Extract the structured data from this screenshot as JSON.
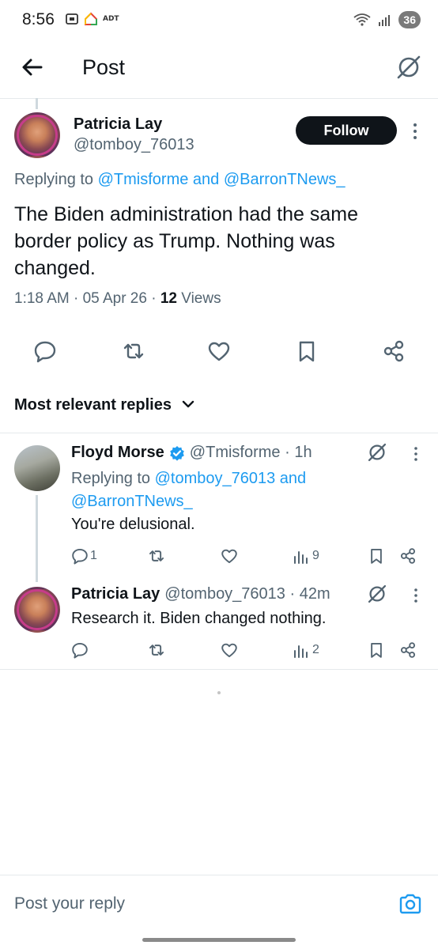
{
  "status_bar": {
    "time": "8:56",
    "adt": "ADT",
    "battery": "36",
    "signal_label": "5"
  },
  "header": {
    "title": "Post"
  },
  "post": {
    "author_name": "Patricia Lay",
    "author_handle": "@tomboy_76013",
    "follow_label": "Follow",
    "replying_prefix": "Replying to",
    "replying_to": "@Tmisforme and @BarronTNews_",
    "text": "The Biden administration had the same border policy as Trump. Nothing was changed.",
    "time": "1:18 AM · 05 Apr 26 · ",
    "views_count": "12",
    "views_label": " Views"
  },
  "sort": {
    "label": "Most relevant replies"
  },
  "replies": [
    {
      "author_name": "Floyd Morse",
      "author_handle": "@Tmisforme · 1h",
      "replying_prefix": "Replying to",
      "replying_to_1": "@tomboy_76013 and",
      "replying_to_2": "@BarronTNews_",
      "text": "You're delusional.",
      "reply_count": "1",
      "views": "9"
    },
    {
      "author_name": "Patricia Lay",
      "author_handle": "@tomboy_76013 · 42m",
      "text": "Research it. Biden changed nothing.",
      "views": "2"
    }
  ],
  "composer": {
    "placeholder": "Post your reply"
  },
  "colors": {
    "accent": "#1d9bf0",
    "text": "#0f1419",
    "muted": "#536471",
    "verified": "#1d9bf0"
  },
  "icons": [
    "back-arrow-icon",
    "grok-icon",
    "reply-icon",
    "repost-icon",
    "like-icon",
    "bookmark-icon",
    "share-icon",
    "views-icon",
    "verified-icon",
    "camera-icon",
    "chevron-down-icon",
    "more-icon"
  ]
}
